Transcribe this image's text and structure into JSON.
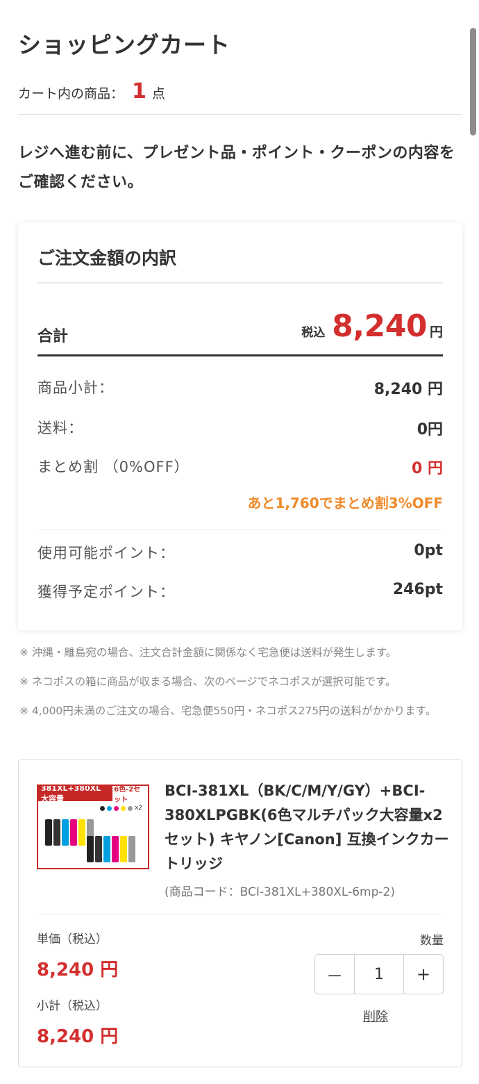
{
  "header": {
    "title": "ショッピングカート",
    "count_label": "カート内の商品：",
    "count": "1",
    "count_unit": "点"
  },
  "notice": "レジへ進む前に、プレゼント品・ポイント・クーポンの内容をご確認ください。",
  "summary": {
    "title": "ご注文金額の内訳",
    "total_label": "合計",
    "total_tax_label": "税込",
    "total_amount": "8,240",
    "total_yen": "円",
    "rows": [
      {
        "label": "商品小計：",
        "value": "8,240 円"
      },
      {
        "label": "送料：",
        "value": "0円"
      },
      {
        "label": "まとめ割 （0%OFF）",
        "value": "0 円"
      }
    ],
    "bulk_hint": "あと1,760でまとめ割3%OFF",
    "points": [
      {
        "label": "使用可能ポイント：",
        "value": "0pt"
      },
      {
        "label": "獲得予定ポイント：",
        "value": "246pt"
      }
    ]
  },
  "notes": [
    "※ 沖縄・離島宛の場合、注文合計金額に関係なく宅急便は送料が発生します。",
    "※ ネコポスの箱に商品が収まる場合、次のページでネコポスが選択可能です。",
    "※ 4,000円未満のご注文の場合、宅急便550円・ネコポス275円の送料がかかります。"
  ],
  "product": {
    "image_banner": "381XL+380XL 大容量",
    "image_tag": "6色-2セット",
    "image_x2": "x2",
    "name": "BCI-381XL（BK/C/M/Y/GY）+BCI-380XLPGBK(6色マルチパック大容量x2セット) キヤノン[Canon] 互換インクカートリッジ",
    "code": "(商品コード：BCI-381XL+380XL-6mp-2)",
    "unit_price_label": "単価（税込）",
    "unit_price": "8,240 円",
    "subtotal_label": "小計（税込）",
    "subtotal": "8,240 円",
    "qty_label": "数量",
    "qty": "1",
    "minus": "－",
    "plus": "+",
    "delete": "削除"
  },
  "colors": {
    "accent_red": "#d32f2f",
    "hint_orange": "#f08a2a",
    "cartridges": [
      "#222222",
      "#333333",
      "#00a0e0",
      "#e4007f",
      "#ffe100",
      "#999999"
    ]
  },
  "icons": [
    "scrollbar-thumb"
  ]
}
